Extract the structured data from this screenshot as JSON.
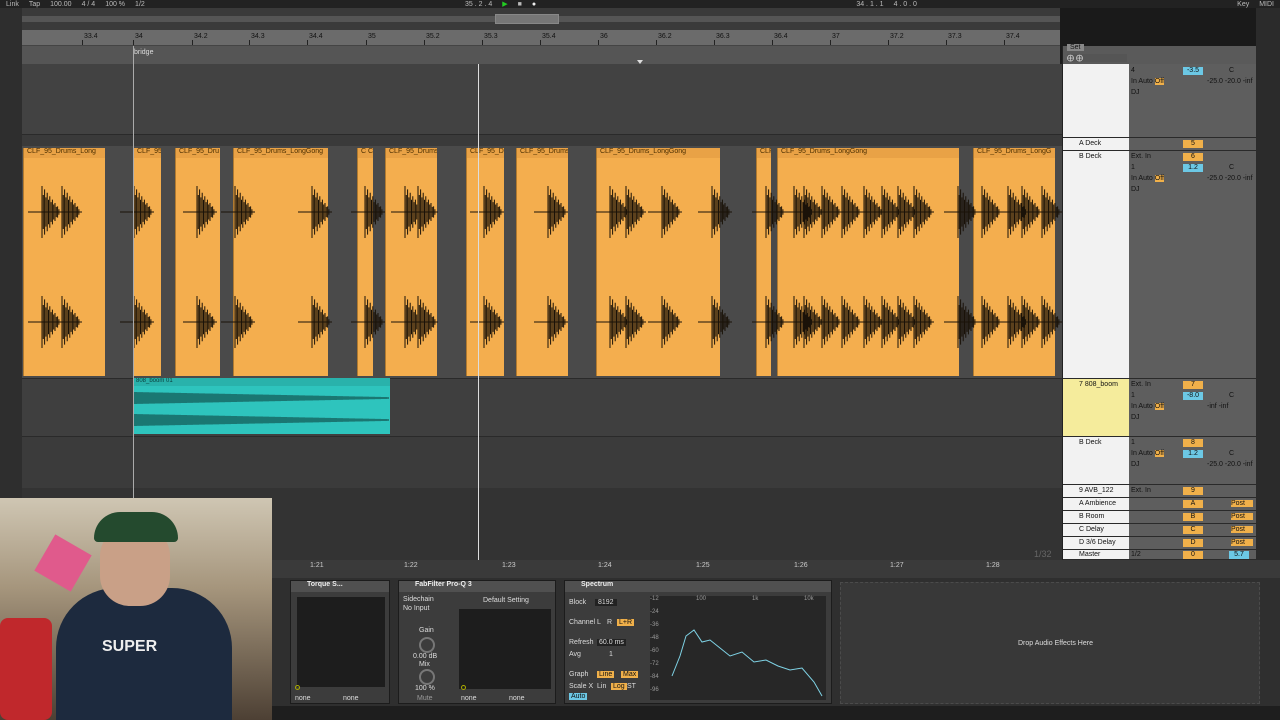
{
  "transport": {
    "link": "Link",
    "tap": "Tap",
    "bpm": "100.00",
    "sig": "4 / 4",
    "zoom": "100 %",
    "quant": "1/2",
    "position": "35 . 2 . 4",
    "end": "34 . 1 . 1",
    "len": "4 . 0 . 0",
    "key": "Key",
    "midi": "MIDI",
    "h": "H",
    "w": "W"
  },
  "ruler": {
    "ticks": [
      "33.4",
      "34",
      "34.2",
      "34.3",
      "34.4",
      "35",
      "35.2",
      "35.3",
      "35.4",
      "36",
      "36.2",
      "36.3",
      "36.4",
      "37",
      "37.2",
      "37.3",
      "37.4"
    ]
  },
  "locator": "bridge",
  "clips": {
    "names": [
      "CLF_95_Drums_Long",
      "CLF_95",
      "CLF_95_Dru",
      "CLF_95_Drums_LongGong",
      "C C",
      "CLF_95_Drums",
      "CLF_95_Dr",
      "CLF_95_Drums",
      "CLF_95_Drums_LongGong",
      "CLF",
      "CLF_95_Drums_LongGong",
      "CLF_95_Drums_LongG"
    ],
    "teal_name": "808_boom 01"
  },
  "mixer": {
    "set": "Set",
    "tracks": [
      {
        "name": "",
        "io": "",
        "num": "",
        "vol": "-3.5",
        "pan": "C",
        "extra": "-25.0  -20.0  -inf",
        "dj": "DJ"
      },
      {
        "name": "A Deck",
        "io": "",
        "num": "5",
        "vol": "",
        "pan": ""
      },
      {
        "name": "B Deck",
        "io": "Ext. In",
        "num": "6",
        "vol": "1.2",
        "pan": "C",
        "extra": "-25.0  -20.0  -inf",
        "dj": "DJ"
      },
      {
        "name": "7 808_boom",
        "io": "Ext. In",
        "num": "7",
        "vol": "-8.0",
        "pan": "C",
        "extra": "-inf  -inf",
        "dj": "DJ"
      },
      {
        "name": "B Deck",
        "io": "",
        "num": "8",
        "vol": "1.2",
        "pan": "C",
        "extra": "-25.0  -20.0  -inf",
        "dj": "DJ"
      },
      {
        "name": "9 AVB_122",
        "io": "Ext. In",
        "num": "9",
        "vol": "",
        "pan": ""
      },
      {
        "name": "A Ambience",
        "io": "",
        "num": "A",
        "vol": "",
        "pan": "Post"
      },
      {
        "name": "B Room",
        "io": "",
        "num": "B",
        "vol": "",
        "pan": "Post"
      },
      {
        "name": "C Delay",
        "io": "",
        "num": "C",
        "vol": "",
        "pan": "Post"
      },
      {
        "name": "D 3/6 Delay",
        "io": "",
        "num": "D",
        "vol": "",
        "pan": "Post"
      },
      {
        "name": "Master",
        "io": "1/2",
        "num": "0",
        "vol": "5.7",
        "pan": ""
      }
    ],
    "in": "In",
    "auto": "Auto",
    "off": "Off",
    "inf": "-inf",
    "one": "1"
  },
  "dev_ruler": [
    "1:21",
    "1:22",
    "1:23",
    "1:24",
    "1:25",
    "1:26",
    "1:27",
    "1:28"
  ],
  "page_count": "1/32",
  "devices": {
    "torque": {
      "title": "Torque S...",
      "none1": "none",
      "none2": "none"
    },
    "fabfilter": {
      "title": "FabFilter Pro-Q 3",
      "sidechain": "Sidechain",
      "no_input": "No Input",
      "preset": "Default Setting",
      "gain": "Gain",
      "gain_val": "0.00 dB",
      "mix": "Mix",
      "mix_val": "100 %",
      "mute": "Mute",
      "none1": "none",
      "none2": "none"
    },
    "spectrum": {
      "title": "Spectrum",
      "block": "Block",
      "block_val": "8192",
      "channel": "Channel",
      "ch_l": "L",
      "ch_r": "R",
      "ch_lr": "L+R",
      "refresh": "Refresh",
      "refresh_val": "60.0 ms",
      "avg": "Avg",
      "avg_val": "1",
      "graph": "Graph",
      "line": "Line",
      "max": "Max",
      "scale": "Scale X",
      "lin": "Lin",
      "log": "Log",
      "st": "ST",
      "auto": "Auto",
      "db": [
        "-12",
        "-24",
        "-36",
        "-48",
        "-60",
        "-72",
        "-84",
        "-96"
      ],
      "freq": [
        "100",
        "1k",
        "10k"
      ]
    },
    "drop": "Drop Audio Effects Here"
  },
  "webcam": {
    "hoodie_text": "SUPER"
  }
}
